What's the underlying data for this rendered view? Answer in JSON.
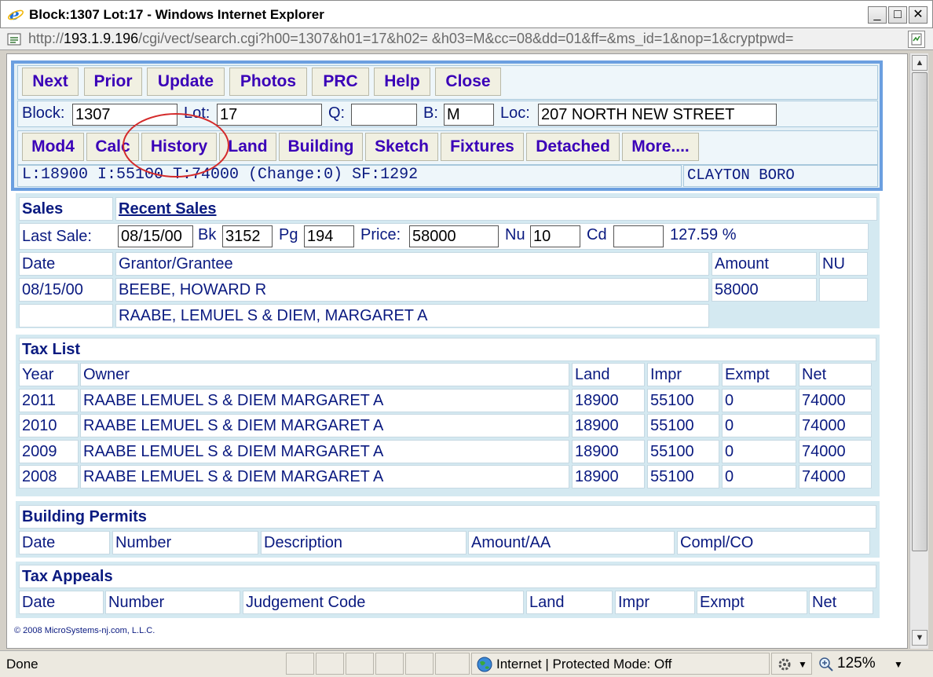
{
  "window": {
    "title": "Block:1307 Lot:17 - Windows Internet Explorer",
    "min": "_",
    "max": "□",
    "close": "✕"
  },
  "address": {
    "scheme": "http://",
    "host": "193.1.9.196",
    "path": "/cgi/vect/search.cgi?h00=1307&h01=17&h02= &h03=M&cc=08&dd=01&ff=&ms_id=1&nop=1&cryptpwd="
  },
  "nav_buttons": [
    "Next",
    "Prior",
    "Update",
    "Photos",
    "PRC",
    "Help",
    "Close"
  ],
  "search": {
    "block_label": "Block:",
    "block": "1307",
    "lot_label": "Lot:",
    "lot": "17",
    "q_label": "Q:",
    "q": "",
    "b_label": "B:",
    "b": "M",
    "loc_label": "Loc:",
    "loc": "207 NORTH NEW STREET"
  },
  "tab_buttons": [
    "Mod4",
    "Calc",
    "History",
    "Land",
    "Building",
    "Sketch",
    "Fixtures",
    "Detached",
    "More...."
  ],
  "summary": {
    "values": "L:18900 I:55100 T:74000 (Change:0) SF:1292",
    "municipality": "CLAYTON BORO"
  },
  "sales": {
    "title": "Sales",
    "link": "Recent Sales",
    "last_sale_label": "Last Sale:",
    "last_sale_date": "08/15/00",
    "bk_label": "Bk",
    "bk": "3152",
    "pg_label": "Pg",
    "pg": "194",
    "price_label": "Price:",
    "price": "58000",
    "nu_label": "Nu",
    "nu": "10",
    "cd_label": "Cd",
    "cd": "",
    "ratio": "127.59 %",
    "headers": {
      "date": "Date",
      "grantor": "Grantor/Grantee",
      "amount": "Amount",
      "nu": "NU"
    },
    "row1": {
      "date": "08/15/00",
      "grantor": "BEEBE, HOWARD R",
      "amount": "58000",
      "nu": ""
    },
    "row2": {
      "date": "",
      "grantee": "RAABE, LEMUEL S & DIEM, MARGARET A"
    }
  },
  "taxlist": {
    "title": "Tax List",
    "headers": {
      "year": "Year",
      "owner": "Owner",
      "land": "Land",
      "impr": "Impr",
      "exmpt": "Exmpt",
      "net": "Net"
    },
    "rows": [
      {
        "year": "2011",
        "owner": "RAABE LEMUEL S & DIEM MARGARET A",
        "land": "18900",
        "impr": "55100",
        "exmpt": "0",
        "net": "74000"
      },
      {
        "year": "2010",
        "owner": "RAABE LEMUEL S & DIEM MARGARET A",
        "land": "18900",
        "impr": "55100",
        "exmpt": "0",
        "net": "74000"
      },
      {
        "year": "2009",
        "owner": "RAABE LEMUEL S & DIEM MARGARET A",
        "land": "18900",
        "impr": "55100",
        "exmpt": "0",
        "net": "74000"
      },
      {
        "year": "2008",
        "owner": "RAABE LEMUEL S & DIEM MARGARET A",
        "land": "18900",
        "impr": "55100",
        "exmpt": "0",
        "net": "74000"
      }
    ]
  },
  "permits": {
    "title": "Building Permits",
    "headers": [
      "Date",
      "Number",
      "Description",
      "Amount/AA",
      "Compl/CO"
    ]
  },
  "appeals": {
    "title": "Tax Appeals",
    "headers": [
      "Date",
      "Number",
      "Judgement Code",
      "Land",
      "Impr",
      "Exmpt",
      "Net"
    ]
  },
  "copyright": "© 2008 MicroSystems-nj.com, L.L.C.",
  "status": {
    "done": "Done",
    "zone": "Internet | Protected Mode: Off",
    "zoom": "125%"
  },
  "colors": {
    "button_text": "#3a00b8",
    "label_text": "#0a1a80",
    "highlight_circle": "#d42a2a",
    "panel_border": "#6b9fe0"
  }
}
